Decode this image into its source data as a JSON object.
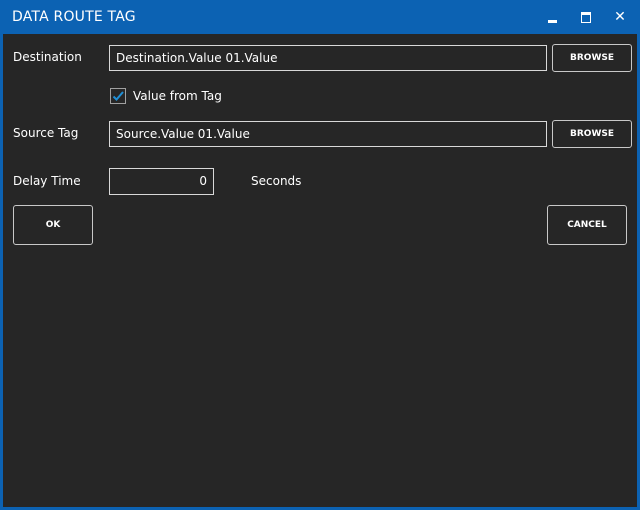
{
  "window": {
    "title": "DATA ROUTE TAG",
    "controls": {
      "minimize_icon": "minimize-icon",
      "maximize_icon": "maximize-icon",
      "close_glyph": "✕"
    }
  },
  "form": {
    "destination": {
      "label": "Destination",
      "value": "Destination.Value 01.Value",
      "browse_label": "BROWSE"
    },
    "value_from_tag": {
      "label": "Value from Tag",
      "checked": true
    },
    "source_tag": {
      "label": "Source Tag",
      "value": "Source.Value 01.Value",
      "browse_label": "BROWSE"
    },
    "delay_time": {
      "label": "Delay Time",
      "value": "0",
      "unit": "Seconds"
    }
  },
  "actions": {
    "ok_label": "OK",
    "cancel_label": "CANCEL"
  },
  "colors": {
    "titlebar": "#0c62b3",
    "background": "#262626",
    "checkmark": "#1f8fd6",
    "text": "#ffffff"
  }
}
